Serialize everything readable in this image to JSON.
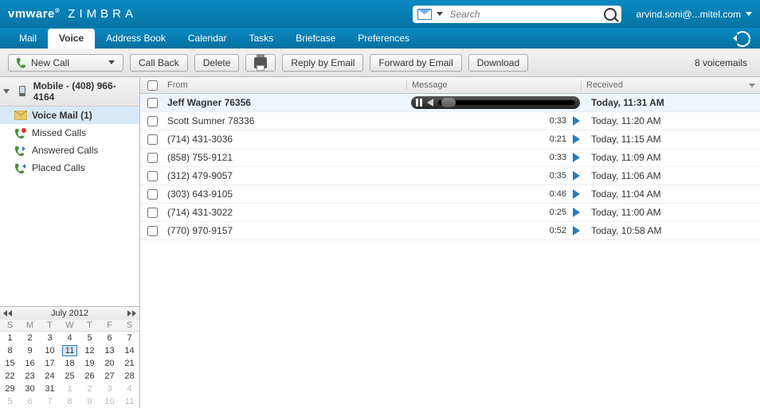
{
  "brand": {
    "vmware": "vmware",
    "reg": "®",
    "zimbra": "ZIMBRA"
  },
  "search": {
    "placeholder": "Search"
  },
  "user": {
    "label": "arvind.soni@...mitel.com"
  },
  "tabs": [
    "Mail",
    "Voice",
    "Address Book",
    "Calendar",
    "Tasks",
    "Briefcase",
    "Preferences"
  ],
  "active_tab": 1,
  "toolbar": {
    "new_call": "New Call",
    "call_back": "Call Back",
    "delete": "Delete",
    "reply_email": "Reply by Email",
    "forward_email": "Forward by Email",
    "download": "Download",
    "voicemail_count": "8 voicemails"
  },
  "sidebar": {
    "root": "Mobile - (408) 966-4164",
    "items": [
      {
        "label": "Voice Mail (1)",
        "icon": "mail",
        "selected": true
      },
      {
        "label": "Missed Calls",
        "icon": "missed"
      },
      {
        "label": "Answered Calls",
        "icon": "answered"
      },
      {
        "label": "Placed Calls",
        "icon": "placed"
      }
    ]
  },
  "columns": {
    "from": "From",
    "message": "Message",
    "received": "Received"
  },
  "messages": [
    {
      "from": "Jeff Wagner  76356",
      "duration": "",
      "received": "Today, 11:31 AM",
      "selected": true,
      "playing": true
    },
    {
      "from": "Scott Sumner  78336",
      "duration": "0:33",
      "received": "Today, 11:20 AM"
    },
    {
      "from": "(714) 431-3036",
      "duration": "0:21",
      "received": "Today, 11:15 AM"
    },
    {
      "from": "(858) 755-9121",
      "duration": "0:33",
      "received": "Today, 11:09 AM"
    },
    {
      "from": "(312) 479-9057",
      "duration": "0:35",
      "received": "Today, 11:06 AM"
    },
    {
      "from": "(303) 643-9105",
      "duration": "0:46",
      "received": "Today, 11:04 AM"
    },
    {
      "from": "(714) 431-3022",
      "duration": "0:25",
      "received": "Today, 11:00 AM"
    },
    {
      "from": "(770) 970-9157",
      "duration": "0:52",
      "received": "Today, 10:58 AM"
    }
  ],
  "calendar": {
    "title": "July 2012",
    "dow": [
      "S",
      "M",
      "T",
      "W",
      "T",
      "F",
      "S"
    ],
    "weeks": [
      [
        {
          "d": 1
        },
        {
          "d": 2
        },
        {
          "d": 3
        },
        {
          "d": 4
        },
        {
          "d": 5
        },
        {
          "d": 6
        },
        {
          "d": 7
        }
      ],
      [
        {
          "d": 8
        },
        {
          "d": 9
        },
        {
          "d": 10
        },
        {
          "d": 11,
          "today": true
        },
        {
          "d": 12
        },
        {
          "d": 13
        },
        {
          "d": 14
        }
      ],
      [
        {
          "d": 15
        },
        {
          "d": 16
        },
        {
          "d": 17
        },
        {
          "d": 18
        },
        {
          "d": 19
        },
        {
          "d": 20
        },
        {
          "d": 21
        }
      ],
      [
        {
          "d": 22
        },
        {
          "d": 23
        },
        {
          "d": 24
        },
        {
          "d": 25
        },
        {
          "d": 26
        },
        {
          "d": 27
        },
        {
          "d": 28
        }
      ],
      [
        {
          "d": 29
        },
        {
          "d": 30
        },
        {
          "d": 31
        },
        {
          "d": 1,
          "dim": true
        },
        {
          "d": 2,
          "dim": true
        },
        {
          "d": 3,
          "dim": true
        },
        {
          "d": 4,
          "dim": true
        }
      ],
      [
        {
          "d": 5,
          "dim": true
        },
        {
          "d": 6,
          "dim": true
        },
        {
          "d": 7,
          "dim": true
        },
        {
          "d": 8,
          "dim": true
        },
        {
          "d": 9,
          "dim": true
        },
        {
          "d": 10,
          "dim": true
        },
        {
          "d": 11,
          "dim": true
        }
      ]
    ]
  }
}
